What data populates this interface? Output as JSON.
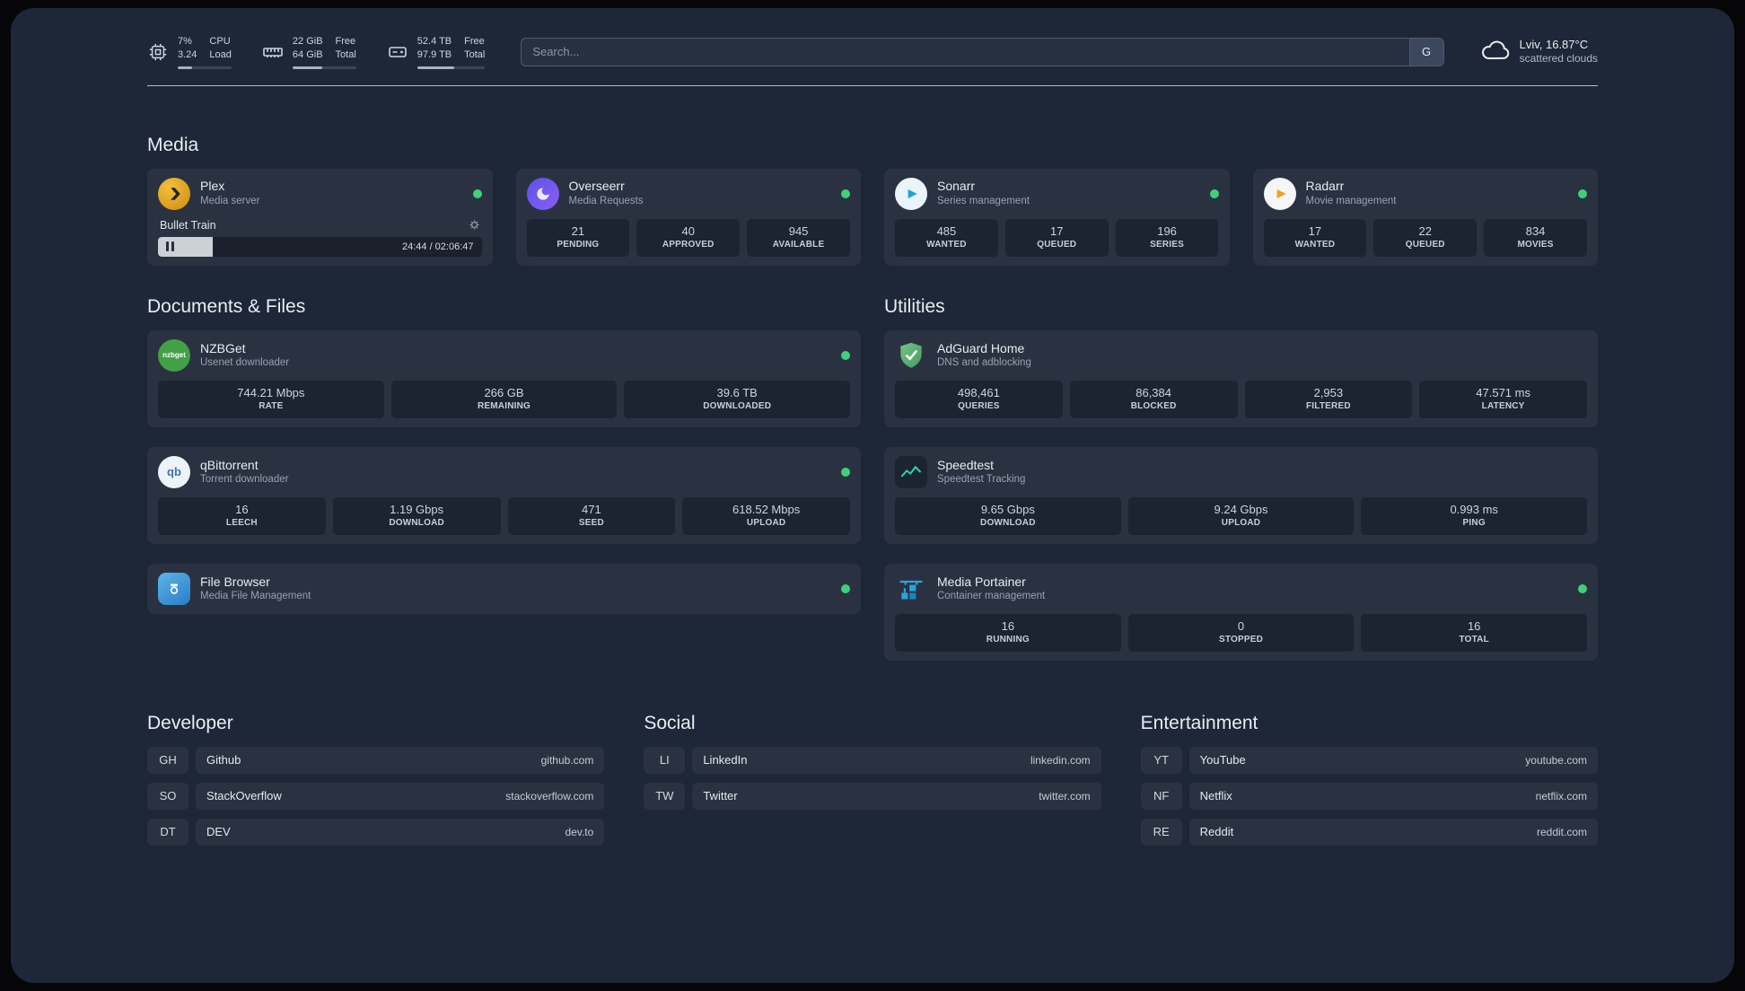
{
  "colors": {
    "background": "#1e2737",
    "card": "#2a3347",
    "status_online": "#3fd07c",
    "plex": "#e5a00d",
    "overseerr": "#6d5cf5",
    "sonarr": "#19a4dc",
    "radarr": "#f0a219",
    "nzbget": "#43a047",
    "qbittorrent": "#3873b3",
    "filebrowser": "#3f97d5",
    "adguard": "#67b279",
    "speedtest": "#2dd4a7",
    "portainer": "#2aa3dc"
  },
  "topbar": {
    "cpu": {
      "line1": "7%",
      "line2": "3.24",
      "lab1": "CPU",
      "lab2": "Load",
      "bar": "width:26%"
    },
    "mem": {
      "line1": "22 GiB",
      "line2": "64 GiB",
      "lab1": "Free",
      "lab2": "Total",
      "bar": "width:46%"
    },
    "disk": {
      "line1": "52.4 TB",
      "line2": "97.9 TB",
      "lab1": "Free",
      "lab2": "Total",
      "bar": "width:54%"
    },
    "search_placeholder": "Search...",
    "search_button": "G",
    "weather_location": "Lviv, 16.87°C",
    "weather_condition": "scattered clouds"
  },
  "media": {
    "title": "Media",
    "plex": {
      "name": "Plex",
      "desc": "Media server",
      "track": "Bullet Train",
      "time": "24:44 / 02:06:47",
      "progress_style": "width:17%"
    },
    "overseerr": {
      "name": "Overseerr",
      "desc": "Media Requests",
      "stats": [
        {
          "v": "21",
          "l": "PENDING"
        },
        {
          "v": "40",
          "l": "APPROVED"
        },
        {
          "v": "945",
          "l": "AVAILABLE"
        }
      ]
    },
    "sonarr": {
      "name": "Sonarr",
      "desc": "Series management",
      "stats": [
        {
          "v": "485",
          "l": "WANTED"
        },
        {
          "v": "17",
          "l": "QUEUED"
        },
        {
          "v": "196",
          "l": "SERIES"
        }
      ]
    },
    "radarr": {
      "name": "Radarr",
      "desc": "Movie management",
      "stats": [
        {
          "v": "17",
          "l": "WANTED"
        },
        {
          "v": "22",
          "l": "QUEUED"
        },
        {
          "v": "834",
          "l": "MOVIES"
        }
      ]
    }
  },
  "documents": {
    "title": "Documents & Files",
    "nzbget": {
      "name": "NZBGet",
      "desc": "Usenet downloader",
      "icon_text": "nzbget",
      "stats": [
        {
          "v": "744.21 Mbps",
          "l": "RATE"
        },
        {
          "v": "266 GB",
          "l": "REMAINING"
        },
        {
          "v": "39.6 TB",
          "l": "DOWNLOADED"
        }
      ]
    },
    "qbittorrent": {
      "name": "qBittorrent",
      "desc": "Torrent downloader",
      "icon_text": "qb",
      "stats": [
        {
          "v": "16",
          "l": "LEECH"
        },
        {
          "v": "1.19 Gbps",
          "l": "DOWNLOAD"
        },
        {
          "v": "471",
          "l": "SEED"
        },
        {
          "v": "618.52 Mbps",
          "l": "UPLOAD"
        }
      ]
    },
    "filebrowser": {
      "name": "File Browser",
      "desc": "Media File Management"
    }
  },
  "utilities": {
    "title": "Utilities",
    "adguard": {
      "name": "AdGuard Home",
      "desc": "DNS and adblocking",
      "stats": [
        {
          "v": "498,461",
          "l": "QUERIES"
        },
        {
          "v": "86,384",
          "l": "BLOCKED"
        },
        {
          "v": "2,953",
          "l": "FILTERED"
        },
        {
          "v": "47.571 ms",
          "l": "LATENCY"
        }
      ]
    },
    "speedtest": {
      "name": "Speedtest",
      "desc": "Speedtest Tracking",
      "stats": [
        {
          "v": "9.65 Gbps",
          "l": "DOWNLOAD"
        },
        {
          "v": "9.24 Gbps",
          "l": "UPLOAD"
        },
        {
          "v": "0.993 ms",
          "l": "PING"
        }
      ]
    },
    "portainer": {
      "name": "Media Portainer",
      "desc": "Container management",
      "stats": [
        {
          "v": "16",
          "l": "RUNNING"
        },
        {
          "v": "0",
          "l": "STOPPED"
        },
        {
          "v": "16",
          "l": "TOTAL"
        }
      ]
    }
  },
  "bookmarks": {
    "developer": {
      "title": "Developer",
      "items": [
        {
          "abbr": "GH",
          "name": "Github",
          "href": "github.com"
        },
        {
          "abbr": "SO",
          "name": "StackOverflow",
          "href": "stackoverflow.com"
        },
        {
          "abbr": "DT",
          "name": "DEV",
          "href": "dev.to"
        }
      ]
    },
    "social": {
      "title": "Social",
      "items": [
        {
          "abbr": "LI",
          "name": "LinkedIn",
          "href": "linkedin.com"
        },
        {
          "abbr": "TW",
          "name": "Twitter",
          "href": "twitter.com"
        }
      ]
    },
    "entertainment": {
      "title": "Entertainment",
      "items": [
        {
          "abbr": "YT",
          "name": "YouTube",
          "href": "youtube.com"
        },
        {
          "abbr": "NF",
          "name": "Netflix",
          "href": "netflix.com"
        },
        {
          "abbr": "RE",
          "name": "Reddit",
          "href": "reddit.com"
        }
      ]
    }
  }
}
